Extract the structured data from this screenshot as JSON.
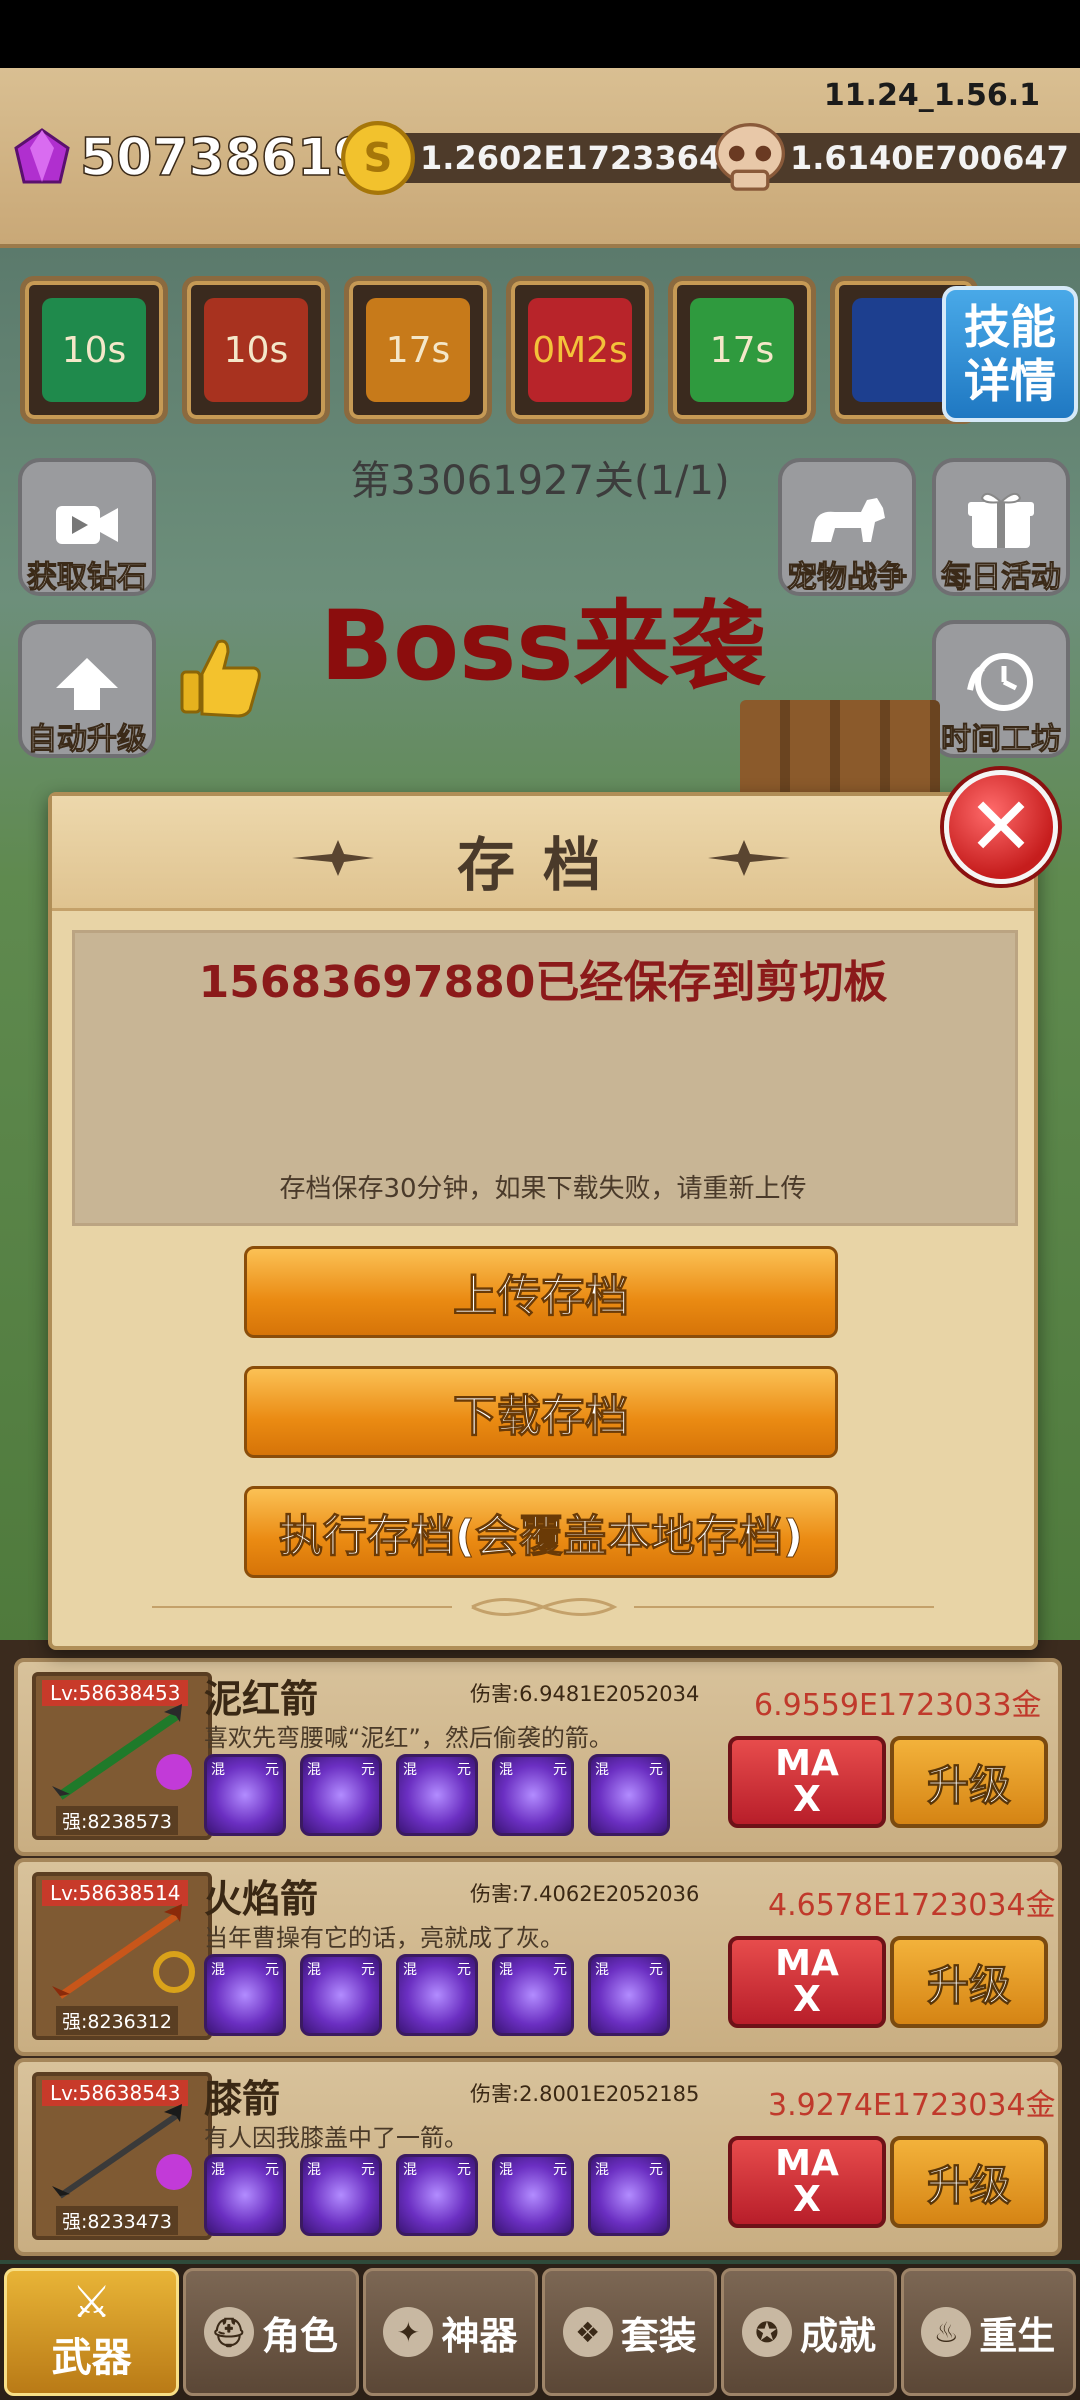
{
  "version": "11.24_1.56.1",
  "resources": {
    "gems": "50738619",
    "gold": "1.2602E1723364",
    "skulls": "1.6140E700647"
  },
  "skills": [
    {
      "timer": "10s",
      "color": "#1f8a4c"
    },
    {
      "timer": "10s",
      "color": "#a8321f"
    },
    {
      "timer": "17s",
      "color": "#c77a1a"
    },
    {
      "timer": "0M2s",
      "color": "#b8242a"
    },
    {
      "timer": "17s",
      "color": "#2f9a3e"
    },
    {
      "timer": "",
      "color": "#1d3f8f"
    }
  ],
  "skill_details_label": "技能详情",
  "stage_text": "第33061927关(1/1)",
  "side_buttons": {
    "get_diamonds": "获取钻石",
    "auto_upgrade": "自动升级",
    "pet_war": "宠物战争",
    "daily_event": "每日活动",
    "time_workshop": "时间工坊"
  },
  "boss_banner": "Boss来袭",
  "dialog": {
    "title": "存档",
    "message": "15683697880已经保存到剪切板",
    "note": "存档保存30分钟，如果下载失败，请重新上传",
    "upload_label": "上传存档",
    "download_label": "下载存档",
    "execute_label": "执行存档(会覆盖本地存档)"
  },
  "weapons": [
    {
      "level": "Lv:58638453",
      "strength": "强:8238573",
      "name": "泥红箭",
      "damage": "伤害:6.9481E2052034",
      "desc": "喜欢先弯腰喊“泥红”，然后偷袭的箭。",
      "cost": "6.9559E1723033金",
      "max_label": "MAX",
      "upgrade_label": "升级"
    },
    {
      "level": "Lv:58638514",
      "strength": "强:8236312",
      "name": "火焰箭",
      "damage": "伤害:7.4062E2052036",
      "desc": "当年曹操有它的话，亮就成了灰。",
      "cost": "4.6578E1723034金",
      "max_label": "MAX",
      "upgrade_label": "升级"
    },
    {
      "level": "Lv:58638543",
      "strength": "强:8233473",
      "name": "膝箭",
      "damage": "伤害:2.8001E2052185",
      "desc": "有人因我膝盖中了一箭。",
      "cost": "3.9274E1723034金",
      "max_label": "MAX",
      "upgrade_label": "升级"
    }
  ],
  "gem_slot_tags": [
    "混",
    "元"
  ],
  "tabs": [
    "武器",
    "角色",
    "神器",
    "套装",
    "成就",
    "重生"
  ]
}
